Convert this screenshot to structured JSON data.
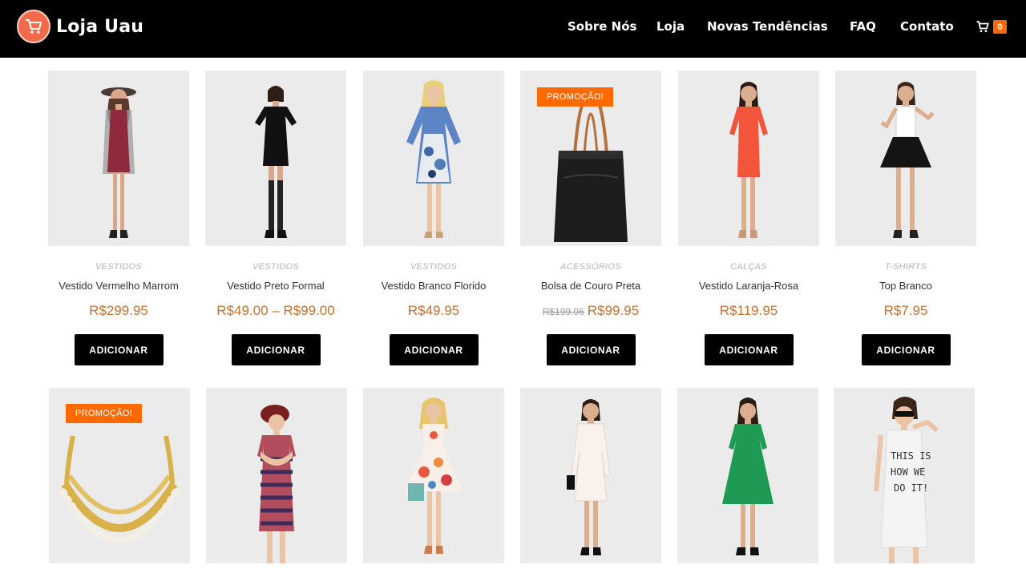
{
  "brand": {
    "name": "Loja Uau",
    "icon": "shopping-cart-icon",
    "color": "#f26a4b"
  },
  "nav": {
    "items": [
      {
        "label": "Sobre Nós"
      },
      {
        "label": "Loja"
      },
      {
        "label": "Novas Tendências"
      },
      {
        "label": "FAQ"
      },
      {
        "label": "Contato"
      }
    ],
    "cart_count": "0",
    "cart_icon": "cart-icon"
  },
  "colors": {
    "accent": "#ff6a00",
    "price": "#c5712f",
    "header_bg": "#000000"
  },
  "products": [
    {
      "category": "VESTIDOS",
      "title": "Vestido Vermelho Marrom",
      "price": "R$299.95",
      "button": "ADICIONAR"
    },
    {
      "category": "VESTIDOS",
      "title": "Vestido Preto Formal",
      "price": "R$49.00 – R$99.00",
      "button": "ADICIONAR"
    },
    {
      "category": "VESTIDOS",
      "title": "Vestido Branco Florido",
      "price": "R$49.95",
      "button": "ADICIONAR"
    },
    {
      "category": "ACESSÓRIOS",
      "title": "Bolsa de Couro Preta",
      "price_old": "R$199.96",
      "price": "R$99.95",
      "button": "ADICIONAR",
      "badge": "PROMOÇÃO!"
    },
    {
      "category": "CALÇAS",
      "title": "Vestido Laranja-Rosa",
      "price": "R$119.95",
      "button": "ADICIONAR"
    },
    {
      "category": "T-SHIRTS",
      "title": "Top Branco",
      "price": "R$7.95",
      "button": "ADICIONAR"
    },
    {
      "badge": "PROMOÇÃO!"
    },
    {},
    {},
    {},
    {},
    {
      "shirt_text": "THIS IS HOW WE DO IT!"
    }
  ]
}
